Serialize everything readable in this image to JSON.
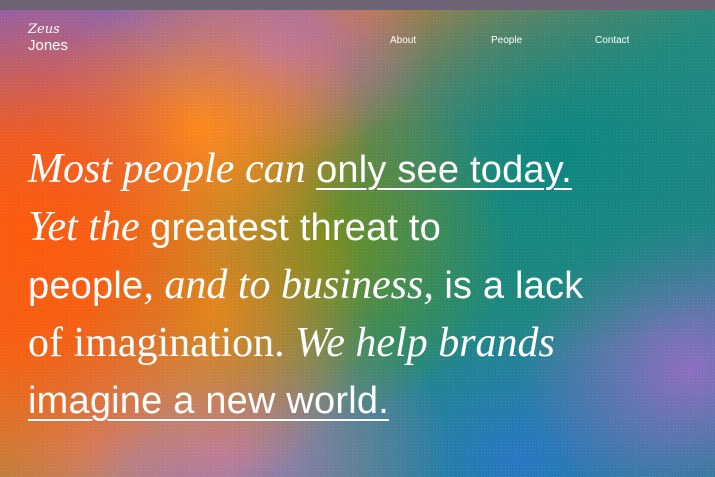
{
  "brand": {
    "name_top": "Zeus",
    "name_bottom": "Jones"
  },
  "nav": {
    "items": [
      {
        "label": "About"
      },
      {
        "label": "People"
      },
      {
        "label": "Contact"
      }
    ]
  },
  "hero": {
    "line1": {
      "italic": "Most people can ",
      "link": "only see today."
    },
    "line2": {
      "italic": "Yet the ",
      "sans": "greatest threat to"
    },
    "line3": {
      "sans_a": "people",
      "italic": ", and to business, ",
      "sans_b": "is a lack"
    },
    "line4": {
      "serif": "of imagination. ",
      "italic": "We help brands"
    },
    "line5": {
      "link": "imagine a new world."
    }
  },
  "colors": {
    "text": "#ffffff",
    "top_bar": "#6e6475",
    "orange": "#ff5a0c",
    "teal": "#0c8781",
    "purple": "#8d63c0"
  }
}
